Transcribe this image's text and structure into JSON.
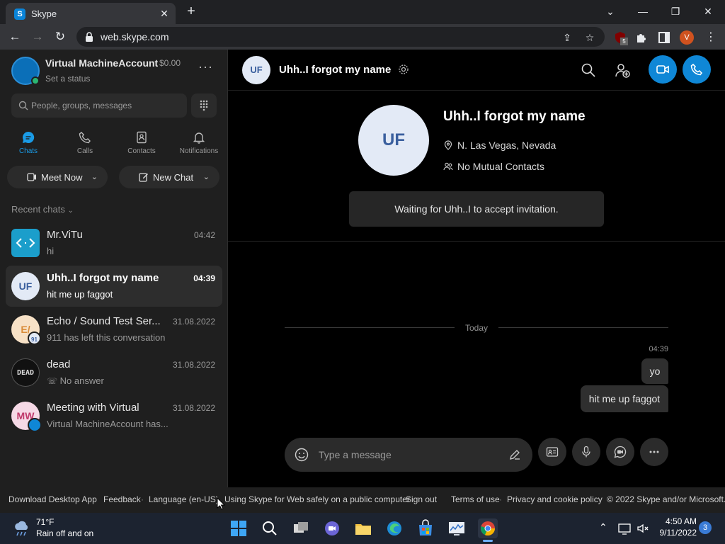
{
  "browser": {
    "tab_title": "Skype",
    "tab_icon_letter": "S",
    "url": "web.skype.com",
    "ext_badge": "5",
    "profile_letter": "V"
  },
  "profile": {
    "name": "Virtual MachineAccount",
    "balance": "$0.00",
    "status": "Set a status"
  },
  "search": {
    "placeholder": "People, groups, messages"
  },
  "nav_tabs": [
    {
      "label": "Chats",
      "active": true
    },
    {
      "label": "Calls"
    },
    {
      "label": "Contacts"
    },
    {
      "label": "Notifications"
    }
  ],
  "actions": {
    "meet_now": "Meet Now",
    "new_chat": "New Chat"
  },
  "recent_header": "Recent chats",
  "chats": [
    {
      "name": "Mr.ViTu",
      "time": "04:42",
      "preview": "hi",
      "avatar_icon": "code-brackets-icon"
    },
    {
      "name": "Uhh..I forgot my name",
      "time": "04:39",
      "preview": "hit me up faggot",
      "initials": "UF",
      "active": true
    },
    {
      "name": "Echo / Sound Test Ser...",
      "time": "31.08.2022",
      "preview": "911 has left this conversation",
      "initials": "E/",
      "badge": "91"
    },
    {
      "name": "dead",
      "time": "31.08.2022",
      "preview": "No answer",
      "avatar_text": "DEAD"
    },
    {
      "name": "Meeting with Virtual",
      "time": "31.08.2022",
      "preview": "Virtual MachineAccount has...",
      "initials": "MW"
    }
  ],
  "conversation": {
    "name": "Uhh..I forgot my name",
    "initials": "UF",
    "location": "N. Las Vegas, Nevada",
    "mutual": "No Mutual Contacts",
    "waiting": "Waiting for Uhh..I to accept invitation.",
    "date_divider": "Today",
    "msg_time": "04:39",
    "messages": [
      "yo",
      "hit me up faggot"
    ],
    "composer_placeholder": "Type a message"
  },
  "footer": {
    "links": [
      "Download Desktop App",
      "Feedback",
      "Language (en-US)",
      "Using Skype for Web safely on a public computer",
      "Sign out",
      "Terms of use",
      "Privacy and cookie policy",
      "© 2022 Skype and/or Microsoft."
    ]
  },
  "taskbar": {
    "temp": "71°F",
    "condition": "Rain off and on",
    "time": "4:50 AM",
    "date": "9/11/2022",
    "notif_count": "3"
  },
  "colors": {
    "accent": "#0f87d6",
    "sidebar": "#1f1f1f",
    "bubble": "#2f2f2f"
  }
}
